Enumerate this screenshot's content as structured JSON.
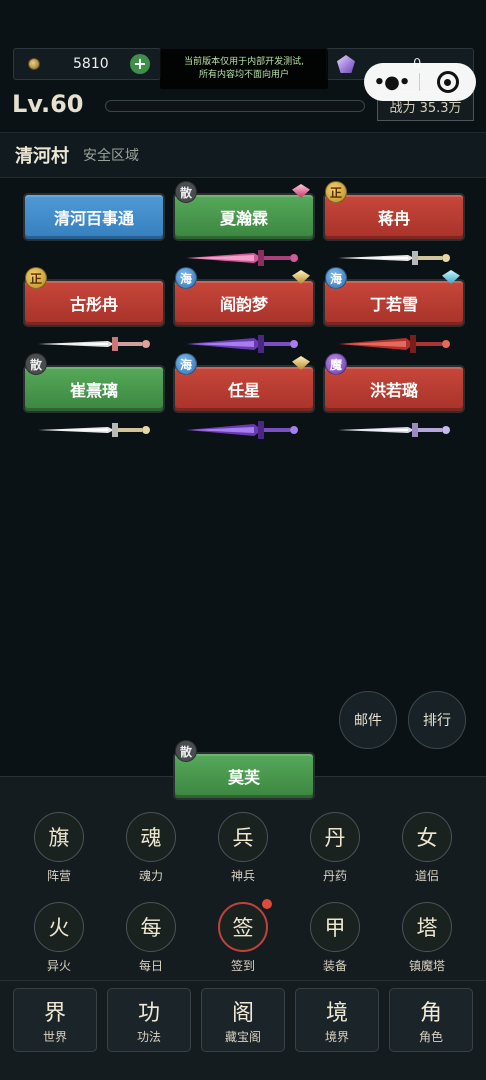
{
  "top_bar": {
    "coins": "5810",
    "crystals": "0",
    "notice_line1": "当前版本仅用于内部开发测试,",
    "notice_line2": "所有内容均不面向用户"
  },
  "player": {
    "level": "Lv.60",
    "exp_progress": 0.0,
    "power": "战力 35.3万"
  },
  "location": {
    "name": "清河村",
    "zone": "安全区域"
  },
  "npcs": [
    {
      "name": "清河百事通",
      "color": "blue",
      "badge": "",
      "gem": ""
    },
    {
      "name": "夏瀚霖",
      "color": "green",
      "badge": "散",
      "badge_style": "gray",
      "gem": "pink",
      "sword": "pink"
    },
    {
      "name": "蒋冉",
      "color": "red",
      "badge": "正",
      "badge_style": "gold",
      "gem": "",
      "sword": "white"
    },
    {
      "name": "古彤冉",
      "color": "red",
      "badge": "正",
      "badge_style": "gold",
      "gem": "",
      "sword": "red"
    },
    {
      "name": "阎韵梦",
      "color": "red",
      "badge": "海",
      "badge_style": "blue",
      "gem": "gold",
      "sword": "purple"
    },
    {
      "name": "丁若雪",
      "color": "red",
      "badge": "海",
      "badge_style": "blue",
      "gem": "teal",
      "sword": "crimson"
    },
    {
      "name": "崔熹璃",
      "color": "green",
      "badge": "散",
      "badge_style": "gray",
      "gem": "",
      "sword": "white"
    },
    {
      "name": "任星",
      "color": "red",
      "badge": "海",
      "badge_style": "blue",
      "gem": "gold",
      "sword": "purple"
    },
    {
      "name": "洪若璐",
      "color": "red",
      "badge": "魔",
      "badge_style": "purple",
      "gem": "",
      "sword": "silver"
    }
  ],
  "side_buttons": {
    "mail": "邮件",
    "rank": "排行"
  },
  "player_npc": {
    "name": "莫芙",
    "badge": "散"
  },
  "feature_grid": [
    {
      "glyph": "旗",
      "label": "阵营",
      "icon": "flag-icon"
    },
    {
      "glyph": "魂",
      "label": "魂力",
      "icon": "soul-icon"
    },
    {
      "glyph": "兵",
      "label": "神兵",
      "icon": "weapon-icon"
    },
    {
      "glyph": "丹",
      "label": "丹药",
      "icon": "pill-icon"
    },
    {
      "glyph": "女",
      "label": "道侣",
      "icon": "partner-icon"
    },
    {
      "glyph": "火",
      "label": "异火",
      "icon": "fire-icon"
    },
    {
      "glyph": "每",
      "label": "每日",
      "icon": "daily-icon"
    },
    {
      "glyph": "签",
      "label": "签到",
      "icon": "checkin-icon",
      "active": true
    },
    {
      "glyph": "甲",
      "label": "装备",
      "icon": "armor-icon"
    },
    {
      "glyph": "塔",
      "label": "镇魔塔",
      "icon": "tower-icon"
    }
  ],
  "bottom_tabs": [
    {
      "glyph": "界",
      "label": "世界"
    },
    {
      "glyph": "功",
      "label": "功法"
    },
    {
      "glyph": "阁",
      "label": "藏宝阁"
    },
    {
      "glyph": "境",
      "label": "境界"
    },
    {
      "glyph": "角",
      "label": "角色"
    }
  ],
  "colors": {
    "npc_red": "#b83c31",
    "npc_green": "#47974c",
    "npc_blue": "#438cca",
    "background": "#0b1216",
    "panel": "#141c20",
    "alert_dot": "#e04a3a"
  }
}
